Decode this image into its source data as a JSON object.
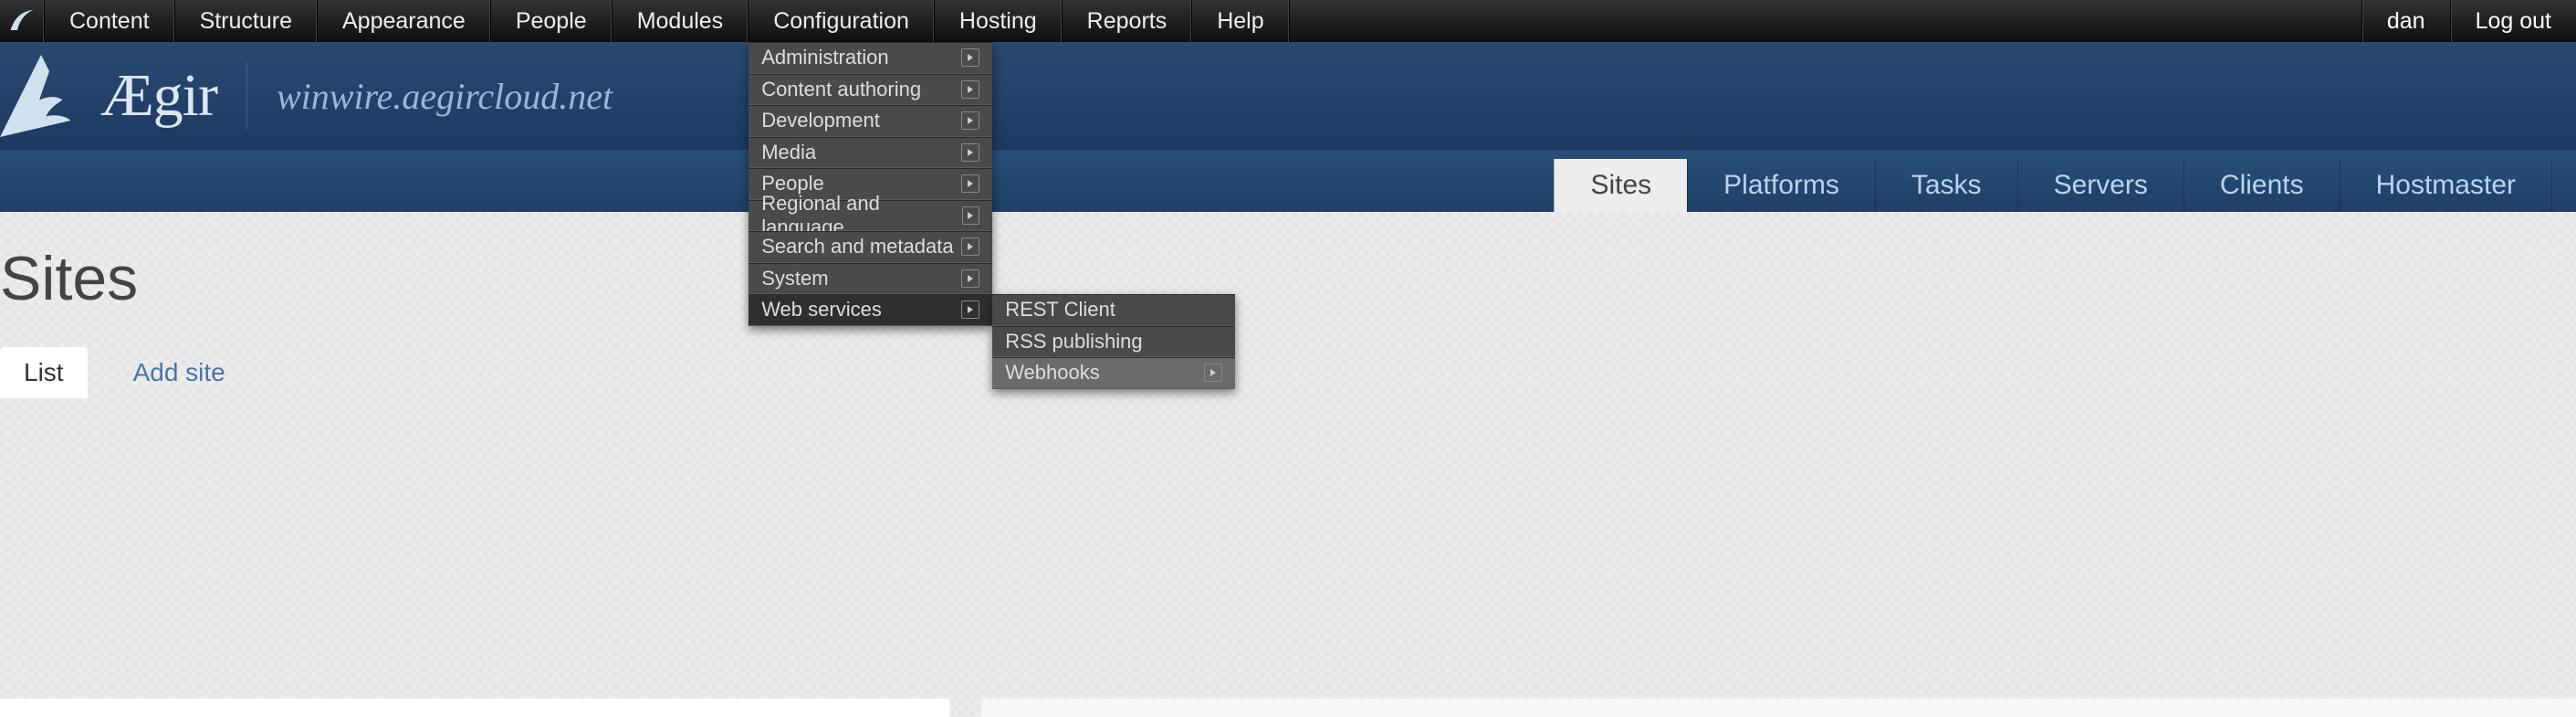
{
  "admin": {
    "items": [
      "Content",
      "Structure",
      "Appearance",
      "People",
      "Modules",
      "Configuration",
      "Hosting",
      "Reports",
      "Help"
    ],
    "right": {
      "user": "dan",
      "logout": "Log out"
    },
    "config_submenu": [
      {
        "label": "Administration",
        "expand": true
      },
      {
        "label": "Content authoring",
        "expand": true
      },
      {
        "label": "Development",
        "expand": true
      },
      {
        "label": "Media",
        "expand": true
      },
      {
        "label": "People",
        "expand": true
      },
      {
        "label": "Regional and language",
        "expand": true
      },
      {
        "label": "Search and metadata",
        "expand": true
      },
      {
        "label": "System",
        "expand": true
      },
      {
        "label": "Web services",
        "expand": true
      }
    ],
    "webservices_submenu": [
      {
        "label": "REST Client",
        "expand": false
      },
      {
        "label": "RSS publishing",
        "expand": false
      },
      {
        "label": "Webhooks",
        "expand": true
      }
    ]
  },
  "brand": {
    "name": "Ægir",
    "site": "winwire.aegircloud.net"
  },
  "navtabs": [
    "Sites",
    "Platforms",
    "Tasks",
    "Servers",
    "Clients",
    "Hostmaster"
  ],
  "navtabs_active_index": 0,
  "page": {
    "title": "Sites"
  },
  "local_tabs": {
    "list": "List",
    "add": "Add site",
    "active_index": 0
  }
}
